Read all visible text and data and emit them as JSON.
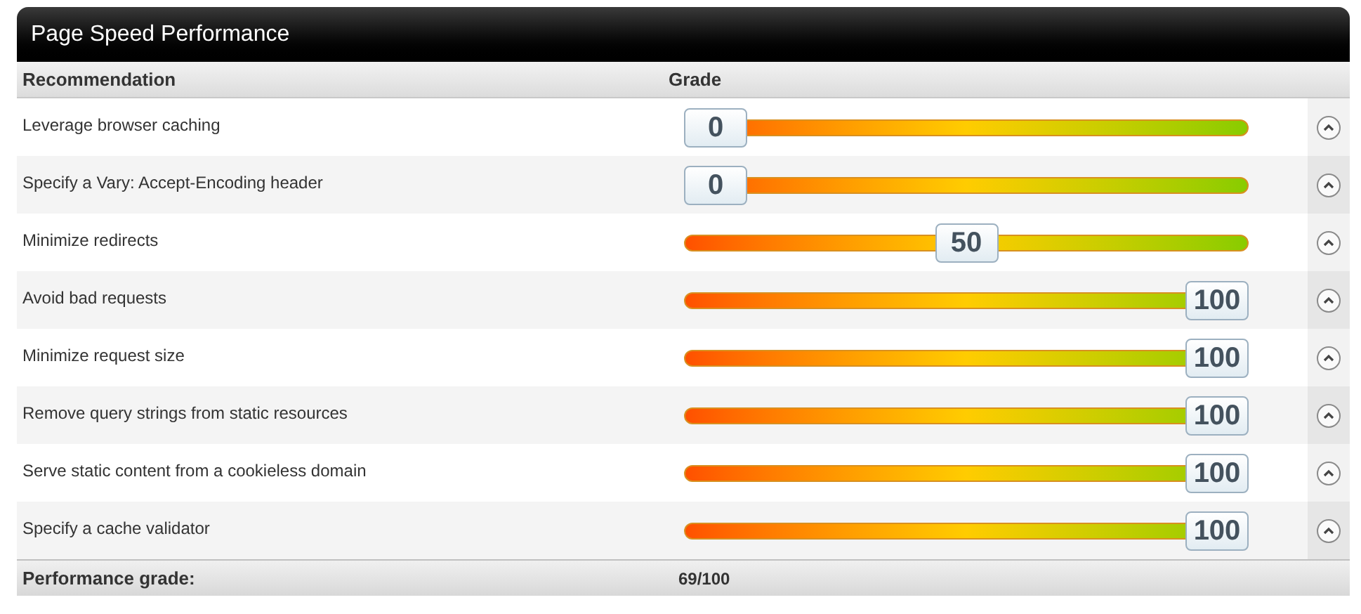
{
  "title": "Page Speed Performance",
  "columns": [
    "Recommendation",
    "Grade"
  ],
  "rows": [
    {
      "name": "Leverage browser caching",
      "grade": "0",
      "level": 0
    },
    {
      "name": "Specify a Vary: Accept-Encoding header",
      "grade": "0",
      "level": 0
    },
    {
      "name": "Minimize redirects",
      "grade": "50",
      "level": 0.5
    },
    {
      "name": "Avoid bad requests",
      "grade": "100",
      "level": 1
    },
    {
      "name": "Minimize request size",
      "grade": "100",
      "level": 1
    },
    {
      "name": "Remove query strings from static resources",
      "grade": "100",
      "level": 1
    },
    {
      "name": "Serve static content from a cookieless domain",
      "grade": "100",
      "level": 1
    },
    {
      "name": "Specify a cache validator",
      "grade": "100",
      "level": 1
    }
  ],
  "footer": {
    "label": "Performance grade:",
    "value": "69/100"
  }
}
